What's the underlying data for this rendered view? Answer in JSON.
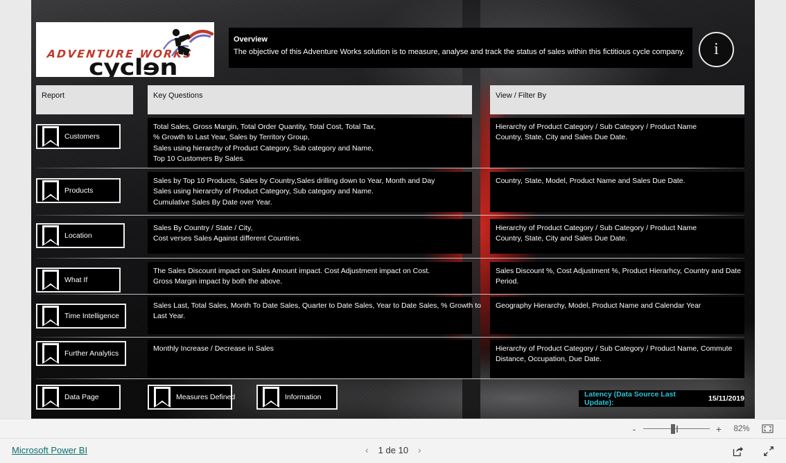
{
  "brand": {
    "logo_line1": "ADVENTURE WORKS",
    "logo_line2": "cycles",
    "logo_alt": "adventure-works-cycles-logo"
  },
  "overview": {
    "title": "Overview",
    "text": "The objective of this Adventure Works solution is to measure, analyse and track the status of sales within this fictitious cycle company.",
    "info_glyph": "i"
  },
  "headers": {
    "report": "Report",
    "key_questions": "Key Questions",
    "view_filter": "View / Filter By"
  },
  "rows": [
    {
      "report": "Customers",
      "key_questions": [
        "Total Sales, Gross Margin, Total Order Quantity, Total Cost, Total Tax,",
        "% Growth to Last Year, Sales by Territory Group,",
        "Sales using hierarchy of Product Category, Sub category and Name,",
        "Top 10 Customers By Sales."
      ],
      "view_filter": [
        "Hierarchy of Product Category / Sub Category / Product Name",
        "Country, State, City and Sales Due Date."
      ]
    },
    {
      "report": "Products",
      "key_questions": [
        "Sales by Top 10 Products, Sales by Country,Sales drilling down to Year, Month and Day",
        "Sales using hierarchy of Product Category, Sub category and Name.",
        "Cumulative Sales By Date over Year."
      ],
      "view_filter": [
        "Country, State, Model, Product Name and Sales Due Date."
      ]
    },
    {
      "report": "Location",
      "key_questions": [
        "Sales By Country / State / City,",
        "Cost verses Sales Against different Countries."
      ],
      "view_filter": [
        "Hierarchy of Product Category / Sub Category / Product Name",
        "Country, State, City and Sales Due Date."
      ]
    },
    {
      "report": "What If",
      "key_questions": [
        "The Sales Discount impact on Sales Amount  impact. Cost Adjustment impact on Cost.",
        "Gross Margin impact by both the above."
      ],
      "view_filter": [
        "Sales Discount %, Cost Adjustment %, Product Hierarhcy, Country and Date",
        "Period."
      ]
    },
    {
      "report": "Time Intelligence",
      "key_questions": [
        "Sales Last, Total Sales, Month To Date Sales, Quarter to Date Sales, Year to Date Sales, % Growth to",
        "Last Year."
      ],
      "view_filter": [
        "Geography Hierarchy, Model, Product Name and Calendar Year"
      ]
    },
    {
      "report": "Further Analytics",
      "key_questions": [
        "Monthly Increase / Decrease in Sales"
      ],
      "view_filter": [
        "Hierarchy of Product Category / Sub Category / Product Name, Commute",
        "Distance, Occupation, Due Date."
      ]
    }
  ],
  "bottom_buttons": [
    {
      "label": "Data Page"
    },
    {
      "label": "Measures Defined"
    },
    {
      "label": "Information"
    }
  ],
  "latency": {
    "key": "Latency (Data Source Last Update):",
    "value": "15/11/2019",
    "key_color": "#27c6d9"
  },
  "zoombar": {
    "minus": "-",
    "plus": "+",
    "percent": "82%",
    "fit_icon": "fit-to-page-icon"
  },
  "statusbar": {
    "brand_link": "Microsoft Power BI",
    "prev_arrow": "‹",
    "next_arrow": "›",
    "page_label": "1 de 10",
    "share_icon": "share-icon",
    "fullscreen_icon": "fullscreen-icon"
  }
}
